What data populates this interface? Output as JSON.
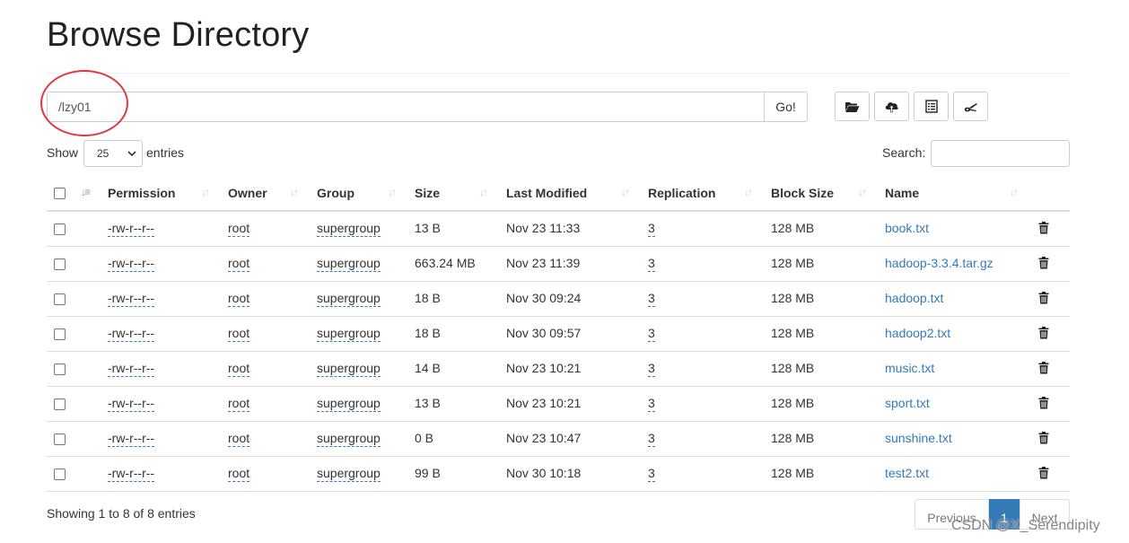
{
  "page": {
    "title": "Browse Directory"
  },
  "path_bar": {
    "value": "/lzy01",
    "go_label": "Go!"
  },
  "toolbar": {
    "icons": [
      "folder-open-icon",
      "cloud-upload-icon",
      "list-alt-icon",
      "scissors-icon"
    ]
  },
  "length_control": {
    "show_label": "Show",
    "selected": "25",
    "entries_label": "entries"
  },
  "search": {
    "label": "Search:",
    "value": ""
  },
  "table": {
    "columns": [
      "Permission",
      "Owner",
      "Group",
      "Size",
      "Last Modified",
      "Replication",
      "Block Size",
      "Name"
    ],
    "rows": [
      {
        "permission": "-rw-r--r--",
        "owner": "root",
        "group": "supergroup",
        "size": "13 B",
        "modified": "Nov 23 11:33",
        "replication": "3",
        "block_size": "128 MB",
        "name": "book.txt"
      },
      {
        "permission": "-rw-r--r--",
        "owner": "root",
        "group": "supergroup",
        "size": "663.24 MB",
        "modified": "Nov 23 11:39",
        "replication": "3",
        "block_size": "128 MB",
        "name": "hadoop-3.3.4.tar.gz"
      },
      {
        "permission": "-rw-r--r--",
        "owner": "root",
        "group": "supergroup",
        "size": "18 B",
        "modified": "Nov 30 09:24",
        "replication": "3",
        "block_size": "128 MB",
        "name": "hadoop.txt"
      },
      {
        "permission": "-rw-r--r--",
        "owner": "root",
        "group": "supergroup",
        "size": "18 B",
        "modified": "Nov 30 09:57",
        "replication": "3",
        "block_size": "128 MB",
        "name": "hadoop2.txt"
      },
      {
        "permission": "-rw-r--r--",
        "owner": "root",
        "group": "supergroup",
        "size": "14 B",
        "modified": "Nov 23 10:21",
        "replication": "3",
        "block_size": "128 MB",
        "name": "music.txt"
      },
      {
        "permission": "-rw-r--r--",
        "owner": "root",
        "group": "supergroup",
        "size": "13 B",
        "modified": "Nov 23 10:21",
        "replication": "3",
        "block_size": "128 MB",
        "name": "sport.txt"
      },
      {
        "permission": "-rw-r--r--",
        "owner": "root",
        "group": "supergroup",
        "size": "0 B",
        "modified": "Nov 23 10:47",
        "replication": "3",
        "block_size": "128 MB",
        "name": "sunshine.txt"
      },
      {
        "permission": "-rw-r--r--",
        "owner": "root",
        "group": "supergroup",
        "size": "99 B",
        "modified": "Nov 30 10:18",
        "replication": "3",
        "block_size": "128 MB",
        "name": "test2.txt"
      }
    ]
  },
  "footer": {
    "info": "Showing 1 to 8 of 8 entries",
    "pagination": {
      "previous": "Previous",
      "current": "1",
      "next": "Next"
    }
  },
  "watermark": "CSDN @X_Serendipity",
  "colors": {
    "link": "#337ab7",
    "annotation_circle": "#e0383e",
    "active_page": "#337ab7"
  }
}
